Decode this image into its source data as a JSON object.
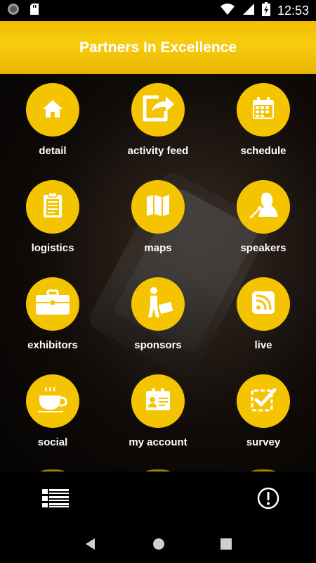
{
  "status_bar": {
    "time": "12:53",
    "left_icons": [
      "circle-icon",
      "sd-card-icon"
    ],
    "right_icons": [
      "wifi-icon",
      "signal-icon",
      "battery-charging-icon"
    ]
  },
  "app_bar": {
    "title": "Partners In Excellence",
    "color": "#f5c400"
  },
  "tiles": [
    {
      "label": "detail",
      "icon": "home-icon"
    },
    {
      "label": "activity feed",
      "icon": "share-icon"
    },
    {
      "label": "schedule",
      "icon": "calendar-icon"
    },
    {
      "label": "logistics",
      "icon": "clipboard-icon"
    },
    {
      "label": "maps",
      "icon": "map-icon"
    },
    {
      "label": "speakers",
      "icon": "speaker-icon"
    },
    {
      "label": "exhibitors",
      "icon": "briefcase-icon"
    },
    {
      "label": "sponsors",
      "icon": "sponsor-icon"
    },
    {
      "label": "live",
      "icon": "rss-icon"
    },
    {
      "label": "social",
      "icon": "coffee-icon"
    },
    {
      "label": "my account",
      "icon": "id-card-icon"
    },
    {
      "label": "survey",
      "icon": "checkbox-icon"
    }
  ],
  "bottom_bar": {
    "left_icon": "list-view-icon",
    "right_icon": "info-alert-icon"
  },
  "nav_bar": {
    "icons": [
      "back-icon",
      "home-icon",
      "recents-icon"
    ]
  }
}
